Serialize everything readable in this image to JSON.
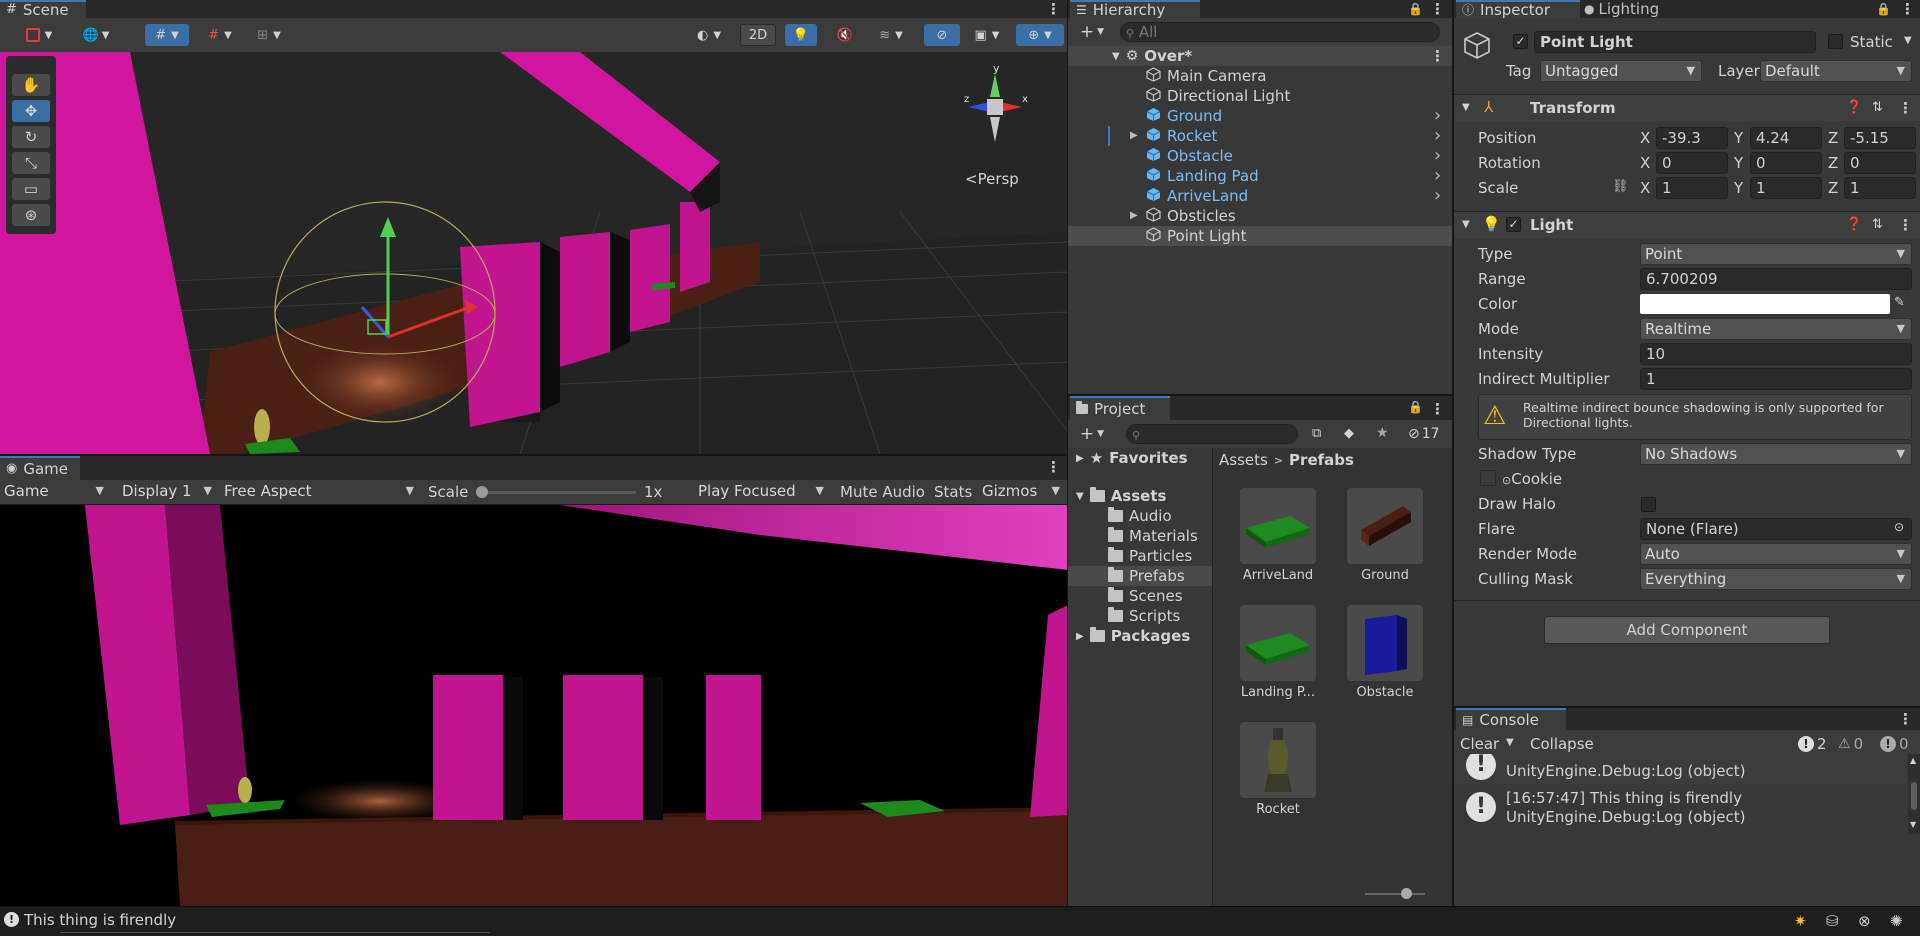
{
  "scene": {
    "tab": "Scene",
    "btn_2d": "2D",
    "persp": "Persp",
    "gizmo_axes": [
      "y",
      "z",
      "x"
    ]
  },
  "game": {
    "tab": "Game",
    "mode": "Game",
    "display": "Display 1",
    "aspect": "Free Aspect",
    "scale_label": "Scale",
    "scale_value": "1x",
    "play_focused": "Play Focused",
    "mute_audio": "Mute Audio",
    "stats": "Stats",
    "gizmos": "Gizmos"
  },
  "hierarchy": {
    "tab": "Hierarchy",
    "search_placeholder": "All",
    "scene_name": "Over*",
    "items": [
      {
        "name": "Main Camera",
        "prefab": false
      },
      {
        "name": "Directional Light",
        "prefab": false
      },
      {
        "name": "Ground",
        "prefab": true
      },
      {
        "name": "Rocket",
        "prefab": true
      },
      {
        "name": "Obstacle",
        "prefab": true
      },
      {
        "name": "Landing Pad",
        "prefab": true
      },
      {
        "name": "ArriveLand",
        "prefab": true
      },
      {
        "name": "Obsticles",
        "prefab": false
      },
      {
        "name": "Point Light",
        "prefab": false
      }
    ]
  },
  "project": {
    "tab": "Project",
    "hidden_count": "17",
    "favorites": "Favorites",
    "assets": "Assets",
    "folders": [
      "Audio",
      "Materials",
      "Particles",
      "Prefabs",
      "Scenes",
      "Scripts"
    ],
    "packages": "Packages",
    "breadcrumb": [
      "Assets",
      "Prefabs"
    ],
    "items": [
      {
        "name": "ArriveLand",
        "color": "#1f8a1f"
      },
      {
        "name": "Ground",
        "color": "#4a1e14"
      },
      {
        "name": "Landing P...",
        "color": "#1f8a1f"
      },
      {
        "name": "Obstacle",
        "color": "#1a1a9a"
      },
      {
        "name": "Rocket",
        "color": "#5a5a2a"
      }
    ]
  },
  "inspector": {
    "tab": "Inspector",
    "tab2": "Lighting",
    "object_name": "Point Light",
    "static_label": "Static",
    "tag_label": "Tag",
    "tag_value": "Untagged",
    "layer_label": "Layer",
    "layer_value": "Default",
    "transform": {
      "title": "Transform",
      "position_label": "Position",
      "pos": [
        "-39.3",
        "4.24",
        "-5.15"
      ],
      "rotation_label": "Rotation",
      "rot": [
        "0",
        "0",
        "0"
      ],
      "scale_label": "Scale",
      "scale": [
        "1",
        "1",
        "1"
      ],
      "axes": [
        "X",
        "Y",
        "Z"
      ]
    },
    "light": {
      "title": "Light",
      "type_label": "Type",
      "type_value": "Point",
      "range_label": "Range",
      "range_value": "6.700209",
      "color_label": "Color",
      "color_value": "#ffffff",
      "mode_label": "Mode",
      "mode_value": "Realtime",
      "intensity_label": "Intensity",
      "intensity_value": "10",
      "indirect_label": "Indirect Multiplier",
      "indirect_value": "1",
      "warning": "Realtime indirect bounce shadowing is only supported for Directional lights.",
      "shadow_label": "Shadow Type",
      "shadow_value": "No Shadows",
      "cookie_label": "Cookie",
      "halo_label": "Draw Halo",
      "flare_label": "Flare",
      "flare_value": "None (Flare)",
      "render_label": "Render Mode",
      "render_value": "Auto",
      "culling_label": "Culling Mask",
      "culling_value": "Everything"
    },
    "add_component": "Add Component"
  },
  "console": {
    "tab": "Console",
    "clear": "Clear",
    "collapse": "Collapse",
    "counts": [
      "2",
      "0",
      "0"
    ],
    "partial_line": "UnityEngine.Debug:Log (object)",
    "entry_line1": "[16:57:47] This thing is firendly",
    "entry_line2": "UnityEngine.Debug:Log (object)"
  },
  "status_bar": {
    "message": "This thing is firendly"
  }
}
